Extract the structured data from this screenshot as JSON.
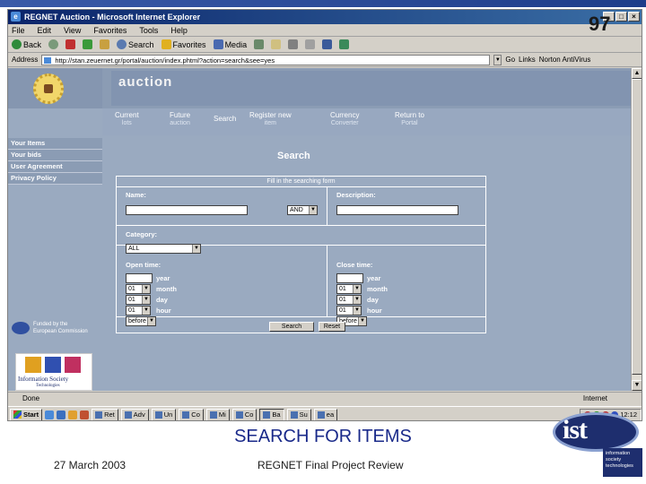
{
  "slide": {
    "number": "97",
    "title": "SEARCH FOR ITEMS",
    "date": "27 March 2003",
    "subtitle": "REGNET Final Project Review",
    "corner_logo": "ist",
    "corner_logo_tagline": [
      "information",
      "society",
      "technologies"
    ]
  },
  "browser": {
    "title": "REGNET Auction - Microsoft Internet Explorer",
    "menu": [
      "File",
      "Edit",
      "View",
      "Favorites",
      "Tools",
      "Help"
    ],
    "toolbar": {
      "back": "Back",
      "search": "Search",
      "favorites": "Favorites",
      "media": "Media"
    },
    "address": {
      "label": "Address",
      "url": "http://stan.zeuernet.gr/portal/auction/index.phtml?action=search&see=yes",
      "go": "Go",
      "links": "Links",
      "links_item": "Norton AntiVirus"
    },
    "status": {
      "text": "Done",
      "zone": "Internet"
    }
  },
  "page": {
    "banner": "auction",
    "nav": [
      {
        "label": "Current",
        "sub": "lots"
      },
      {
        "label": "Future",
        "sub": "auction"
      },
      {
        "label": "Search",
        "sub": ""
      },
      {
        "label": "Register new",
        "sub": "item"
      },
      {
        "label": "Currency",
        "sub": "Converter"
      },
      {
        "label": "Return to",
        "sub": "Portal"
      }
    ],
    "sidebar": [
      "Your Items",
      "Your bids",
      "User Agreement",
      "Privacy Policy"
    ],
    "sidebar_footer": {
      "eu": [
        "Funded by the",
        "European Commission"
      ],
      "ist": "Information Society",
      "ist_sub": "Technologies"
    },
    "heading": "Search",
    "form": {
      "caption": "Fill in the searching form",
      "name_label": "Name:",
      "name_value": "",
      "operator": "AND",
      "description_label": "Description:",
      "description_value": "",
      "category_label": "Category:",
      "category_value": "ALL",
      "open_time_label": "Open time:",
      "close_time_label": "Close time:",
      "year_label": "year",
      "month_label": "month",
      "day_label": "day",
      "hour_label": "hour",
      "open": {
        "year": "",
        "month": "01",
        "day": "01",
        "hour": "01",
        "when": "before"
      },
      "close": {
        "year": "",
        "month": "01",
        "day": "01",
        "hour": "01",
        "when": "before"
      },
      "search_button": "Search",
      "reset_button": "Reset"
    }
  },
  "taskbar": {
    "start": "Start",
    "tasks": [
      "Ret",
      "Adv",
      "Un",
      "Co",
      "Mi",
      "Co",
      "Ba",
      "Su",
      "ea"
    ],
    "clock": "12:12"
  }
}
